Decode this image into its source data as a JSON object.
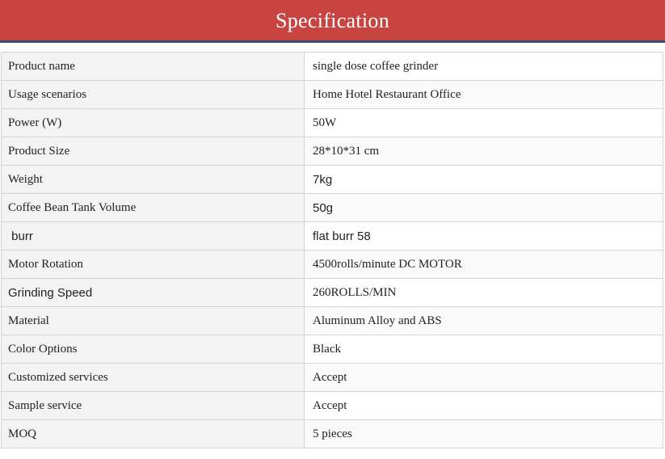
{
  "header": {
    "title": "Specification",
    "colors": {
      "background": "#c74440",
      "accent_line": "#3e4e6b",
      "text": "#ffffff"
    }
  },
  "spec_table": {
    "rows": [
      {
        "label": "Product name",
        "value": "single dose coffee grinder"
      },
      {
        "label": "Usage scenarios",
        "value": "Home Hotel Restaurant Office"
      },
      {
        "label": "Power (W)",
        "value": "50W"
      },
      {
        "label": "Product Size",
        "value": "28*10*31 cm"
      },
      {
        "label": "Weight",
        "value": "7kg"
      },
      {
        "label": "Coffee Bean Tank Volume",
        "value": "50g"
      },
      {
        "label": " burr",
        "value": "flat burr 58"
      },
      {
        "label": "Motor Rotation",
        "value": "4500rolls/minute DC MOTOR"
      },
      {
        "label": "Grinding Speed",
        "value": "260ROLLS/MIN"
      },
      {
        "label": "Material",
        "value": "Aluminum Alloy and ABS"
      },
      {
        "label": "Color Options",
        "value": "Black"
      },
      {
        "label": "Customized services",
        "value": "Accept"
      },
      {
        "label": "Sample service",
        "value": "Accept"
      },
      {
        "label": "MOQ",
        "value": "5 pieces"
      }
    ]
  }
}
